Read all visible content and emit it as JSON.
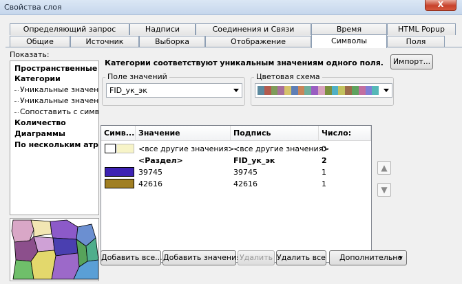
{
  "window": {
    "title": "Свойства слоя",
    "close_label": "X"
  },
  "tabs": {
    "top_row": [
      "Определяющий запрос",
      "Надписи",
      "Соединения и Связи",
      "Время",
      "HTML Popup"
    ],
    "bottom_row": [
      "Общие",
      "Источник",
      "Выборка",
      "Отображение",
      "Символы",
      "Поля"
    ],
    "active": "Символы"
  },
  "show": {
    "label": "Показать:",
    "items": [
      "Пространственные объекты",
      "Категории",
      "Уникальные значения",
      "Уникальные значения, много полей",
      "Сопоставить с символами в стиле",
      "Количество",
      "Диаграммы",
      "По нескольким атрибутам"
    ]
  },
  "main": {
    "description": "Категории соответствуют уникальным значениям одного поля.",
    "import_button": "Импорт...",
    "value_field": {
      "label": "Поле значений",
      "value": "FID_ук_эк"
    },
    "color_scheme": {
      "label": "Цветовая схема",
      "colors": [
        "#5c8a9f",
        "#b45b4e",
        "#7f9c5a",
        "#a8709c",
        "#d6c36b",
        "#5e7fb7",
        "#c9855a",
        "#6fae9c",
        "#9a5ec2",
        "#d8a3bd",
        "#7b8f3e",
        "#4fb0c6",
        "#c2c25f",
        "#9b6b4b",
        "#5fa35f",
        "#c26fa0",
        "#7f7fd6",
        "#55b8b8"
      ]
    }
  },
  "table": {
    "headers": [
      "Симв...",
      "Значение",
      "Подпись",
      "Число:"
    ],
    "rows": [
      {
        "color": "#f7f4c8",
        "value": "<все другие значения>",
        "label": "<все другие значения>",
        "count": "0",
        "bold": false
      },
      {
        "color": "",
        "value": "<Раздел>",
        "label": "FID_ук_эк",
        "count": "2",
        "bold": true
      },
      {
        "color": "#3d22b3",
        "value": "39745",
        "label": "39745",
        "count": "1",
        "bold": false
      },
      {
        "color": "#a07f23",
        "value": "42616",
        "label": "42616",
        "count": "1",
        "bold": false
      }
    ]
  },
  "buttons": {
    "add_all": "Добавить все...",
    "add_values": "Добавить значения",
    "remove": "Удалить",
    "remove_all": "Удалить все",
    "advanced": "Дополнительно"
  },
  "icons": {
    "move_up": "arrow-up-icon",
    "move_down": "arrow-down-icon"
  },
  "preview_colors": [
    "#d9a7c7",
    "#9c69c9",
    "#6b8fd1",
    "#6fbf6a",
    "#e3d86c",
    "#8c5a9e",
    "#4fae8c",
    "#c15b6e",
    "#5a9fd6",
    "#d6a05e"
  ]
}
